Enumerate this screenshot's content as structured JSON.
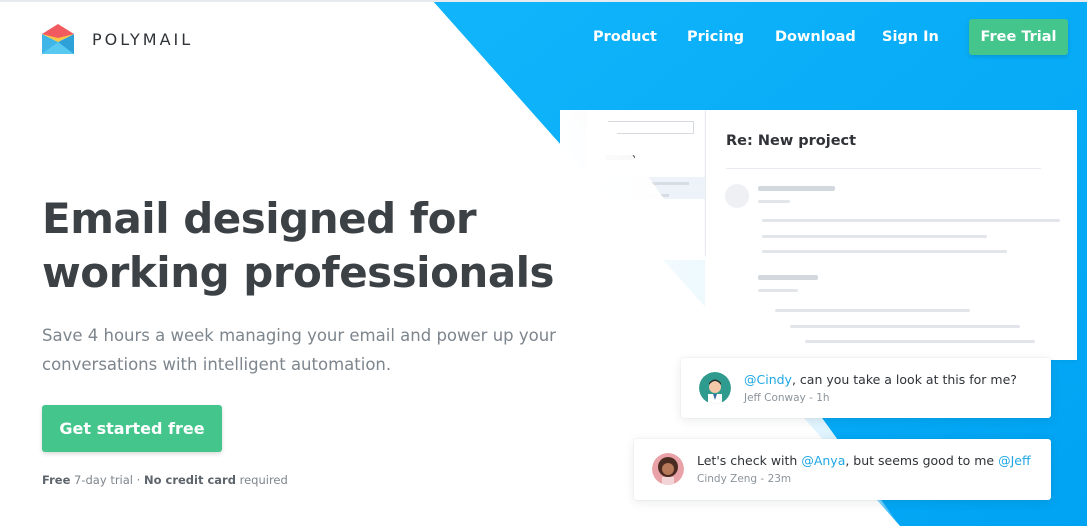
{
  "brand": {
    "name": "POLYMAIL",
    "accent": "#44c58c",
    "wedge_color": "#10b5fb",
    "logo_icon": "envelope-logo-icon"
  },
  "nav": {
    "items": [
      "Product",
      "Pricing",
      "Download",
      "Sign In"
    ],
    "cta_label": "Free Trial"
  },
  "hero": {
    "title_line1": "Email designed for",
    "title_line2": "working professionals",
    "subtitle": "Save 4 hours a week managing your email and power up your conversations with intelligent automation.",
    "cta_label": "Get started free",
    "fine_print": {
      "part1_bold": "Free",
      "part2": " 7-day trial · ",
      "part3_bold": "No credit card",
      "part4": " required"
    }
  },
  "mockup": {
    "subject": "Re: New project"
  },
  "comments": [
    {
      "mention": "@Cindy",
      "text": ", can you take a look at this for me?",
      "author": "Jeff Conway",
      "time": "1h",
      "avatar": "man-avatar-icon"
    },
    {
      "text_before": "Let's check with ",
      "mention1": "@Anya",
      "text_middle": ", but seems good to me ",
      "mention2": "@Jeff",
      "author": "Cindy Zeng",
      "time": "23m",
      "avatar": "woman-avatar-icon"
    }
  ],
  "colors": {
    "mention": "#1ea7e4",
    "heading": "#3c4146",
    "muted": "#7d858d"
  }
}
